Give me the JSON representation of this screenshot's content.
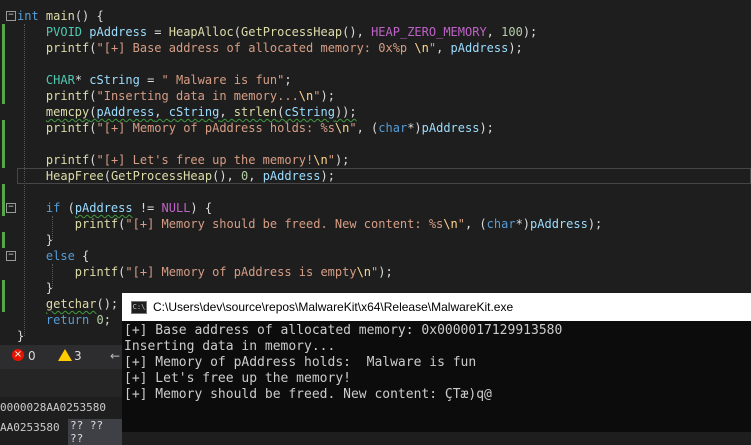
{
  "code_lines": [
    [
      {
        "t": "int",
        "c": "kw"
      },
      {
        "t": " "
      },
      {
        "t": "main",
        "c": "fn"
      },
      {
        "t": "() {"
      }
    ],
    [
      {
        "t": "    "
      },
      {
        "t": "PVOID",
        "c": "ty"
      },
      {
        "t": " "
      },
      {
        "t": "pAddress",
        "c": "var"
      },
      {
        "t": " = "
      },
      {
        "t": "HeapAlloc",
        "c": "fn"
      },
      {
        "t": "("
      },
      {
        "t": "GetProcessHeap",
        "c": "fn"
      },
      {
        "t": "(), "
      },
      {
        "t": "HEAP_ZERO_MEMORY",
        "c": "mac"
      },
      {
        "t": ", "
      },
      {
        "t": "100",
        "c": "num"
      },
      {
        "t": ");"
      }
    ],
    [
      {
        "t": "    "
      },
      {
        "t": "printf",
        "c": "fn"
      },
      {
        "t": "("
      },
      {
        "t": "\"[+] Base address of allocated memory: 0x%p ",
        "c": "str"
      },
      {
        "t": "\\n",
        "c": "esc"
      },
      {
        "t": "\"",
        "c": "str"
      },
      {
        "t": ", "
      },
      {
        "t": "pAddress",
        "c": "var"
      },
      {
        "t": ");"
      }
    ],
    [],
    [
      {
        "t": "    "
      },
      {
        "t": "CHAR",
        "c": "ty"
      },
      {
        "t": "* "
      },
      {
        "t": "cString",
        "c": "var"
      },
      {
        "t": " = "
      },
      {
        "t": "\" Malware is fun\"",
        "c": "str"
      },
      {
        "t": ";"
      }
    ],
    [
      {
        "t": "    "
      },
      {
        "t": "printf",
        "c": "fn"
      },
      {
        "t": "("
      },
      {
        "t": "\"Inserting data in memory...",
        "c": "str"
      },
      {
        "t": "\\n",
        "c": "esc"
      },
      {
        "t": "\"",
        "c": "str"
      },
      {
        "t": ");"
      }
    ],
    [
      {
        "t": "    "
      },
      {
        "t": "memcpy",
        "c": "fn sq"
      },
      {
        "t": "(",
        "c": "sq"
      },
      {
        "t": "pAddress",
        "c": "var sq"
      },
      {
        "t": ", ",
        "c": "sq"
      },
      {
        "t": "cString",
        "c": "var sq"
      },
      {
        "t": ", ",
        "c": "sq"
      },
      {
        "t": "strlen",
        "c": "fn sq"
      },
      {
        "t": "(",
        "c": "sq"
      },
      {
        "t": "cString",
        "c": "var sq"
      },
      {
        "t": "));",
        "c": "sq"
      }
    ],
    [
      {
        "t": "    "
      },
      {
        "t": "printf",
        "c": "fn"
      },
      {
        "t": "("
      },
      {
        "t": "\"[+] Memory of pAddress holds: %s",
        "c": "str"
      },
      {
        "t": "\\n",
        "c": "esc"
      },
      {
        "t": "\"",
        "c": "str"
      },
      {
        "t": ", ("
      },
      {
        "t": "char",
        "c": "kw"
      },
      {
        "t": "*)"
      },
      {
        "t": "pAddress",
        "c": "var"
      },
      {
        "t": ");"
      }
    ],
    [],
    [
      {
        "t": "    "
      },
      {
        "t": "printf",
        "c": "fn"
      },
      {
        "t": "("
      },
      {
        "t": "\"[+] Let's free up the memory!",
        "c": "str"
      },
      {
        "t": "\\n",
        "c": "esc"
      },
      {
        "t": "\"",
        "c": "str"
      },
      {
        "t": ");"
      }
    ],
    [
      {
        "t": "    "
      },
      {
        "t": "HeapFree",
        "c": "fn"
      },
      {
        "t": "("
      },
      {
        "t": "GetProcessHeap",
        "c": "fn"
      },
      {
        "t": "(), "
      },
      {
        "t": "0",
        "c": "num"
      },
      {
        "t": ", "
      },
      {
        "t": "pAddress",
        "c": "var"
      },
      {
        "t": ");"
      }
    ],
    [],
    [
      {
        "t": "    "
      },
      {
        "t": "if",
        "c": "kw"
      },
      {
        "t": " ("
      },
      {
        "t": "pAddress",
        "c": "var sq"
      },
      {
        "t": " != "
      },
      {
        "t": "NULL",
        "c": "mac"
      },
      {
        "t": ") {"
      }
    ],
    [
      {
        "t": "        "
      },
      {
        "t": "printf",
        "c": "fn"
      },
      {
        "t": "("
      },
      {
        "t": "\"[+] Memory should be freed. New content: %s",
        "c": "str"
      },
      {
        "t": "\\n",
        "c": "esc"
      },
      {
        "t": "\"",
        "c": "str"
      },
      {
        "t": ", ("
      },
      {
        "t": "char",
        "c": "kw"
      },
      {
        "t": "*)"
      },
      {
        "t": "pAddress",
        "c": "var"
      },
      {
        "t": ");"
      }
    ],
    [
      {
        "t": "    }"
      }
    ],
    [
      {
        "t": "    "
      },
      {
        "t": "else",
        "c": "kw"
      },
      {
        "t": " {"
      }
    ],
    [
      {
        "t": "        "
      },
      {
        "t": "printf",
        "c": "fn"
      },
      {
        "t": "("
      },
      {
        "t": "\"[+] Memory of pAddress is empty",
        "c": "str"
      },
      {
        "t": "\\n",
        "c": "esc"
      },
      {
        "t": "\"",
        "c": "str"
      },
      {
        "t": ");"
      }
    ],
    [
      {
        "t": "    }"
      }
    ],
    [
      {
        "t": "    "
      },
      {
        "t": "getchar",
        "c": "fn sq"
      },
      {
        "t": "();"
      }
    ],
    [
      {
        "t": "    "
      },
      {
        "t": "return",
        "c": "kw"
      },
      {
        "t": " "
      },
      {
        "t": "0",
        "c": "num"
      },
      {
        "t": ";"
      }
    ],
    [
      {
        "t": "}"
      }
    ]
  ],
  "status": {
    "errors": "0",
    "warnings": "3",
    "error_icon": "error-circle-icon",
    "warning_icon": "warning-triangle-icon",
    "nav_icon": "left-arrow-icon"
  },
  "memory": {
    "row1": "0000028AA0253580",
    "row2": "AA0253580",
    "bytes": "?? ?? ??"
  },
  "console": {
    "title": "C:\\Users\\dev\\source\\repos\\MalwareKit\\x64\\Release\\MalwareKit.exe",
    "icon_text": "C:\\",
    "lines": [
      "[+] Base address of allocated memory: 0x0000017129913580",
      "Inserting data in memory...",
      "[+] Memory of pAddress holds:  Malware is fun",
      "[+] Let's free up the memory!",
      "[+] Memory should be freed. New content: ÇTæ)q@"
    ]
  },
  "colors": {
    "editor_bg": "#1e1e1e",
    "change_bar": "#57a64a",
    "console_bg": "#0c0c0c"
  }
}
